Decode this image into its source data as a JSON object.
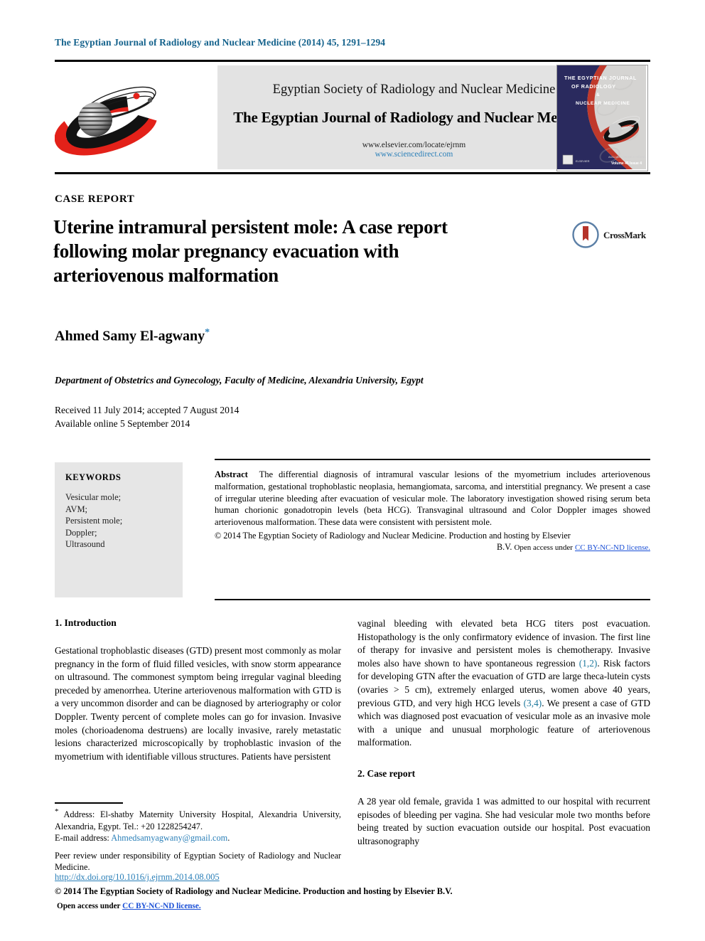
{
  "running_head": "The Egyptian Journal of Radiology and Nuclear Medicine (2014) 45, 1291–1294",
  "masthead": {
    "society": "Egyptian Society of Radiology and Nuclear Medicine",
    "journal": "The Egyptian Journal of Radiology and Nuclear Medicine",
    "url_elsevier": "www.elsevier.com/locate/ejrnm",
    "url_sciencedirect": "www.sciencedirect.com",
    "society_logo_name": "egyptian-society-radiology-logo",
    "cover": {
      "line1": "THE EGYPTIAN JOURNAL",
      "line2": "OF RADIOLOGY",
      "line3": "&",
      "line4": "NUCLEAR MEDICINE",
      "footer_right": "Volume 45 Issue 4"
    }
  },
  "article": {
    "type_label": "CASE REPORT",
    "title": "Uterine intramural persistent mole: A case report following molar pregnancy evacuation with arteriovenous malformation",
    "crossmark_label": "CrossMark",
    "author": "Ahmed Samy El-agwany",
    "author_footnote_marker": "*",
    "affiliation": "Department of Obstetrics and Gynecology, Faculty of Medicine, Alexandria University, Egypt",
    "received_line": "Received 11 July 2014; accepted 7 August 2014",
    "available_line": "Available online 5 September 2014"
  },
  "keywords": {
    "title": "KEYWORDS",
    "items": [
      "Vesicular mole;",
      "AVM;",
      "Persistent mole;",
      "Doppler;",
      "Ultrasound"
    ]
  },
  "abstract": {
    "label": "Abstract",
    "text": "The differential diagnosis of intramural vascular lesions of the myometrium includes arteriovenous malformation, gestational trophoblastic neoplasia, hemangiomata, sarcoma, and interstitial pregnancy. We present a case of irregular uterine bleeding after evacuation of vesicular mole. The laboratory investigation showed rising serum beta human chorionic gonadotropin levels (beta HCG). Transvaginal ultrasound and Color Doppler images showed arteriovenous malformation. These data were consistent with persistent mole.",
    "copyright": "© 2014 The Egyptian Society of Radiology and Nuclear Medicine. Production and hosting by Elsevier",
    "copyright_tail": "B.V.",
    "openaccess_prefix": "Open access under",
    "license_text": "CC BY-NC-ND license."
  },
  "sections": {
    "introduction_heading": "1. Introduction",
    "introduction_left": "Gestational trophoblastic diseases (GTD) present most commonly as molar pregnancy in the form of fluid filled vesicles, with snow storm appearance on ultrasound. The commonest symptom being irregular vaginal bleeding preceded by amenorrhea. Uterine arteriovenous malformation with GTD is a very uncommon disorder and can be diagnosed by arteriography or color Doppler. Twenty percent of complete moles can go for invasion. Invasive moles (chorioadenoma destruens) are locally invasive, rarely metastatic lesions characterized microscopically by trophoblastic invasion of the myometrium with identifiable villous structures. Patients have persistent",
    "introduction_right_part1": "vaginal bleeding with elevated beta HCG titers post evacuation. Histopathology is the only confirmatory evidence of invasion. The first line of therapy for invasive and persistent moles is chemotherapy. Invasive moles also have shown to have spontaneous regression ",
    "citation_1": "(1,2)",
    "introduction_right_part2": ". Risk factors for developing GTN after the evacuation of GTD are large theca-lutein cysts (ovaries  > 5 cm), extremely enlarged uterus, women above 40 years, previous GTD, and very high HCG levels ",
    "citation_2": "(3,4)",
    "introduction_right_part3": ". We present a case of GTD which was diagnosed post evacuation of vesicular mole as an invasive mole with a unique and unusual morphologic feature of arteriovenous malformation.",
    "case_report_heading": "2. Case report",
    "case_report_text": "A 28 year old female, gravida 1 was admitted to our hospital with recurrent episodes of bleeding per vagina. She had vesicular mole two months before being treated by suction evacuation outside our hospital. Post evacuation ultrasonography"
  },
  "footnotes": {
    "address_marker": "*",
    "address": " Address: El-shatby Maternity University Hospital, Alexandria University, Alexandria, Egypt. Tel.: +20 1228254247.",
    "email_label": "E-mail address: ",
    "email": "Ahmedsamyagwany@gmail.com",
    "email_period": ".",
    "peer_review": "Peer review under responsibility of Egyptian Society of Radiology and Nuclear Medicine."
  },
  "footer": {
    "doi": "http://dx.doi.org/10.1016/j.ejrnm.2014.08.005",
    "copyright": "© 2014 The Egyptian Society of Radiology and Nuclear Medicine. Production and hosting by Elsevier B.V.",
    "openaccess_prefix": "Open access under ",
    "license_text": "CC BY-NC-ND license."
  },
  "colors": {
    "header_blue": "#14628c",
    "link_blue": "#2a7fb8",
    "citation_blue": "#1f7a9e",
    "license_blue": "#1a4fd6",
    "masthead_gray": "#e3e3e3",
    "keywords_gray": "#e6e6e6",
    "logo_red": "#e32119",
    "crossmark_red": "#b5332a",
    "cover_navy": "#2a2a5e"
  }
}
